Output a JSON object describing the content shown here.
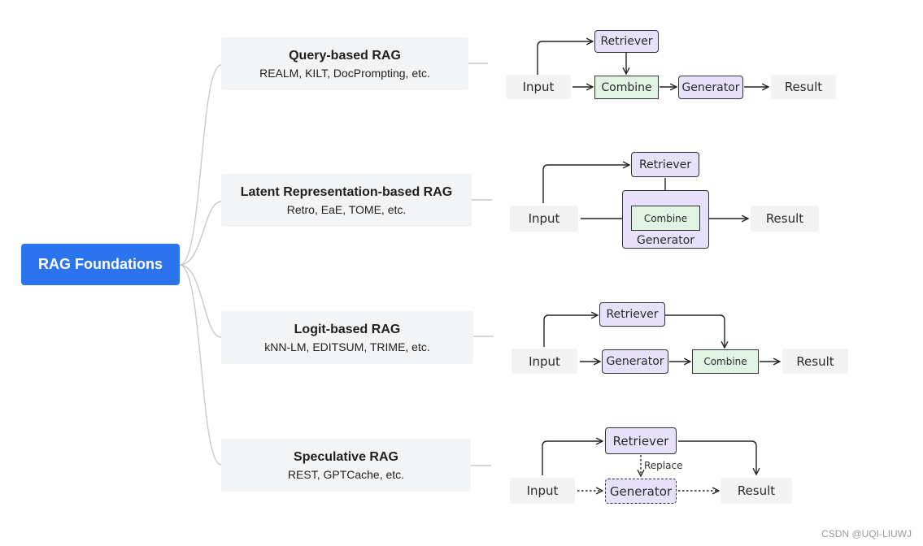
{
  "root": {
    "label": "RAG Foundations",
    "color": "#2b74ee"
  },
  "categories": [
    {
      "title": "Query-based RAG",
      "examples": "REALM, KILT, DocPrompting, etc."
    },
    {
      "title": "Latent Representation-based RAG",
      "examples": "Retro, EaE, TOME, etc."
    },
    {
      "title": "Logit-based RAG",
      "examples": "kNN-LM, EDITSUM, TRIME, etc."
    },
    {
      "title": "Speculative RAG",
      "examples": "REST, GPTCache, etc."
    }
  ],
  "diagrams": {
    "query": {
      "input": "Input",
      "retriever": "Retriever",
      "combine": "Combine",
      "generator": "Generator",
      "result": "Result"
    },
    "latent": {
      "input": "Input",
      "retriever": "Retriever",
      "combine": "Combine",
      "generator": "Generator",
      "result": "Result"
    },
    "logit": {
      "input": "Input",
      "retriever": "Retriever",
      "generator": "Generator",
      "combine": "Combine",
      "result": "Result"
    },
    "speculative": {
      "input": "Input",
      "retriever": "Retriever",
      "replace": "Replace",
      "generator": "Generator",
      "result": "Result"
    }
  },
  "colors": {
    "retriever_generator_fill": "#e8e1fb",
    "combine_fill": "#e1f4e4",
    "io_fill": "#f3f3f3",
    "category_fill": "#f3f4f6"
  },
  "watermark": "CSDN @UQI-LIUWJ"
}
